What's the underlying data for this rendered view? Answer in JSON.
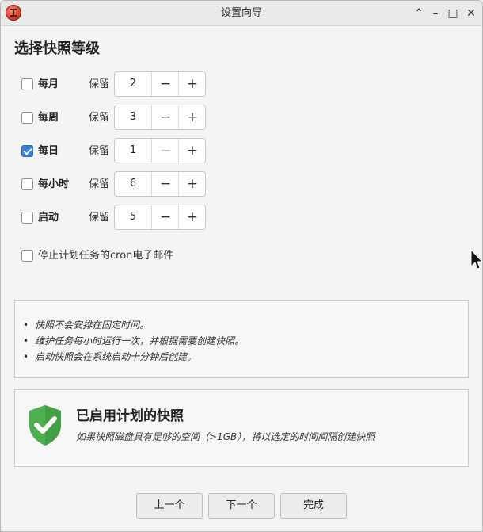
{
  "window": {
    "title": "设置向导",
    "controls": {
      "collapse": "⌃",
      "minimize": "–",
      "maximize": "□",
      "close": "✕"
    }
  },
  "page": {
    "heading": "选择快照等级"
  },
  "levels": [
    {
      "label": "每月",
      "checked": false,
      "keep_label": "保留",
      "value": "2",
      "minus": "−",
      "plus": "+",
      "minus_disabled": false
    },
    {
      "label": "每周",
      "checked": false,
      "keep_label": "保留",
      "value": "3",
      "minus": "−",
      "plus": "+",
      "minus_disabled": false
    },
    {
      "label": "每日",
      "checked": true,
      "keep_label": "保留",
      "value": "1",
      "minus": "−",
      "plus": "+",
      "minus_disabled": true
    },
    {
      "label": "每小时",
      "checked": false,
      "keep_label": "保留",
      "value": "6",
      "minus": "−",
      "plus": "+",
      "minus_disabled": false
    },
    {
      "label": "启动",
      "checked": false,
      "keep_label": "保留",
      "value": "5",
      "minus": "−",
      "plus": "+",
      "minus_disabled": false
    }
  ],
  "cron": {
    "label": "停止计划任务的cron电子邮件",
    "checked": false
  },
  "info": {
    "bullet": "•",
    "lines": [
      "快照不会安排在固定时间。",
      "维护任务每小时运行一次，并根据需要创建快照。",
      "启动快照会在系统启动十分钟后创建。"
    ]
  },
  "status": {
    "icon": "shield-check-icon",
    "title": "已启用计划的快照",
    "description": "如果快照磁盘具有足够的空间（>1GB），将以选定的时间间隔创建快照"
  },
  "buttons": {
    "prev": "上一个",
    "next": "下一个",
    "finish": "完成"
  },
  "colors": {
    "accent": "#3b7fd9",
    "shield": "#4caf50"
  }
}
